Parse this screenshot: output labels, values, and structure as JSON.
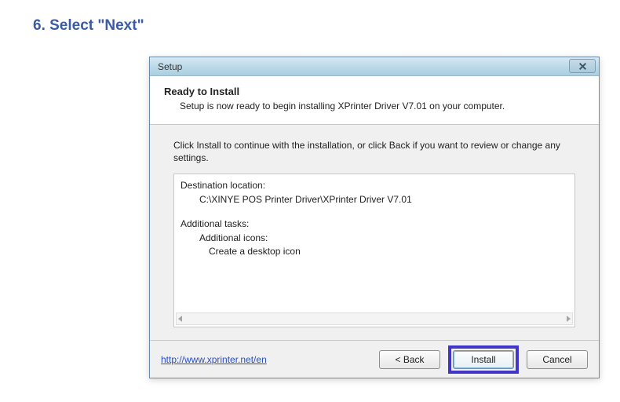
{
  "instruction": "6. Select \"Next\"",
  "dialog": {
    "title": "Setup",
    "header": {
      "title": "Ready to Install",
      "subtitle": "Setup is now ready to begin installing XPrinter Driver V7.01 on your computer."
    },
    "body": {
      "text": "Click Install to continue with the installation, or click Back if you want to review or change any settings.",
      "summary": {
        "dest_label": "Destination location:",
        "dest_value": "C:\\XINYE POS Printer Driver\\XPrinter Driver V7.01",
        "tasks_label": "Additional tasks:",
        "tasks_sub": "Additional icons:",
        "tasks_item": "Create a desktop icon"
      }
    },
    "footer": {
      "link": "http://www.xprinter.net/en",
      "back": "< Back",
      "install": "Install",
      "cancel": "Cancel"
    }
  }
}
